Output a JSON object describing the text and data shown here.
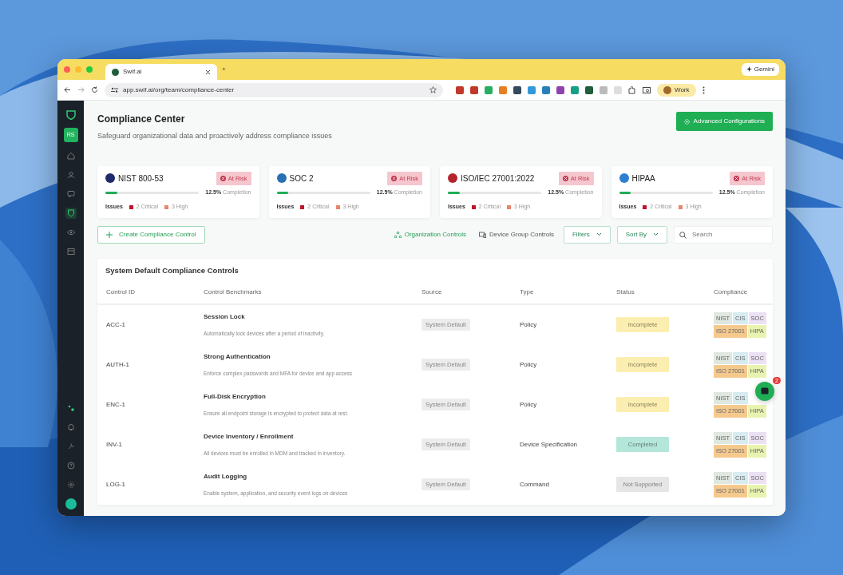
{
  "browser": {
    "tab_title": "Swif.ai",
    "new_tab": "+",
    "assistant": "Gemini",
    "url": "app.swif.ai/org/team/compliance-center",
    "profile": "Work"
  },
  "sidebar": {
    "avatar": "RS",
    "items": [
      {
        "selected": false
      },
      {
        "selected": false
      },
      {
        "selected": false
      },
      {
        "selected": true
      },
      {
        "selected": false
      },
      {
        "selected": false
      }
    ],
    "bottom_items": [
      {
        "selected": false
      },
      {
        "selected": false
      },
      {
        "selected": false
      },
      {
        "selected": false
      },
      {
        "selected": false
      }
    ]
  },
  "header": {
    "title": "Compliance Center",
    "subtitle": "Safeguard organizational data and proactively address compliance issues",
    "action": "Advanced Configurations"
  },
  "frameworks": [
    {
      "name": "NIST 800-53",
      "color": "#1f2a6b",
      "status": "At Risk",
      "level": 0.125,
      "percent": "12.5%",
      "completion_label": "Completion",
      "issues_label": "Issues",
      "critical": "2 Critical",
      "high": "3 High"
    },
    {
      "name": "SOC 2",
      "color": "#2b6fb3",
      "status": "At Risk",
      "level": 0.125,
      "percent": "12.5%",
      "completion_label": "Completion",
      "issues_label": "Issues",
      "critical": "2 Critical",
      "high": "3 High"
    },
    {
      "name": "ISO/IEC 27001:2022",
      "color": "#b3242d",
      "status": "At Risk",
      "level": 0.125,
      "percent": "12.5%",
      "completion_label": "Completion",
      "issues_label": "Issues",
      "critical": "2 Critical",
      "high": "3 High"
    },
    {
      "name": "HIPAA",
      "color": "#2f7fd0",
      "status": "At Risk",
      "level": 0.125,
      "percent": "12.5%",
      "completion_label": "Completion",
      "issues_label": "Issues",
      "critical": "2 Critical",
      "high": "3 High"
    }
  ],
  "toolbar": {
    "create": "Create Compliance Control",
    "views": [
      {
        "label": "Organization Controls",
        "selected": true
      },
      {
        "label": "Device Group Controls",
        "selected": false
      }
    ],
    "filters": "Filters",
    "sort": "Sort By",
    "search": {
      "placeholder": "Search"
    }
  },
  "table": {
    "title": "System Default Compliance Controls",
    "columns": [
      "Control ID",
      "Control Benchmarks",
      "Source",
      "Type",
      "Status",
      "Compliance"
    ],
    "rows": [
      {
        "id": "ACC-1",
        "name": "Session Lock",
        "description": "Automatically lock devices after a period of inactivity.",
        "source": "System Default",
        "type": "Policy",
        "status": {
          "label": "Incomplete",
          "color": "#fbeeb0"
        },
        "compliance": [
          {
            "label": "NIST",
            "color": "#dfe8e0"
          },
          {
            "label": "CIS",
            "color": "#d6ecf0"
          },
          {
            "label": "SOC",
            "color": "#ece0f5"
          },
          {
            "label": "ISO 27001",
            "color": "#f5c98e"
          },
          {
            "label": "HIPA",
            "color": "#e9f3b0"
          }
        ]
      },
      {
        "id": "AUTH-1",
        "name": "Strong Authentication",
        "description": "Enforce complex passwords and MFA for device and app access",
        "source": "System Default",
        "type": "Policy",
        "status": {
          "label": "Incomplete",
          "color": "#fbeeb0"
        },
        "compliance": [
          {
            "label": "NIST",
            "color": "#dfe8e0"
          },
          {
            "label": "CIS",
            "color": "#d6ecf0"
          },
          {
            "label": "SOC",
            "color": "#ece0f5"
          },
          {
            "label": "ISO 27001",
            "color": "#f5c98e"
          },
          {
            "label": "HIPA",
            "color": "#e9f3b0"
          }
        ]
      },
      {
        "id": "ENC-1",
        "name": "Full-Disk Encryption",
        "description": "Ensure all endpoint storage is encrypted to protect data at rest.",
        "source": "System Default",
        "type": "Policy",
        "status": {
          "label": "Incomplete",
          "color": "#fbeeb0"
        },
        "compliance": [
          {
            "label": "NIST",
            "color": "#dfe8e0"
          },
          {
            "label": "CIS",
            "color": "#d6ecf0"
          },
          {
            "label": "ISO 27001",
            "color": "#f5c98e"
          },
          {
            "label": "HIPA",
            "color": "#e9f3b0"
          }
        ]
      },
      {
        "id": "INV-1",
        "name": "Device Inventory / Enrollment",
        "description": "All devices must be enrolled in MDM and tracked in inventory.",
        "source": "System Default",
        "type": "Device Specification",
        "status": {
          "label": "Completed",
          "color": "#b5e6da"
        },
        "compliance": [
          {
            "label": "NIST",
            "color": "#dfe8e0"
          },
          {
            "label": "CIS",
            "color": "#d6ecf0"
          },
          {
            "label": "SOC",
            "color": "#ece0f5"
          },
          {
            "label": "ISO 27001",
            "color": "#f5c98e"
          },
          {
            "label": "HIPA",
            "color": "#e9f3b0"
          }
        ]
      },
      {
        "id": "LOG-1",
        "name": "Audit Logging",
        "description": "Enable system, application, and security event logs on devices",
        "source": "System Default",
        "type": "Command",
        "status": {
          "label": "Not Supported",
          "color": "#e6e6e6"
        },
        "compliance": [
          {
            "label": "NIST",
            "color": "#dfe8e0"
          },
          {
            "label": "CIS",
            "color": "#d6ecf0"
          },
          {
            "label": "SOC",
            "color": "#ece0f5"
          },
          {
            "label": "ISO 27001",
            "color": "#f5c98e"
          },
          {
            "label": "HIPA",
            "color": "#e9f3b0"
          }
        ]
      }
    ]
  },
  "chat": {
    "badge": "2"
  }
}
